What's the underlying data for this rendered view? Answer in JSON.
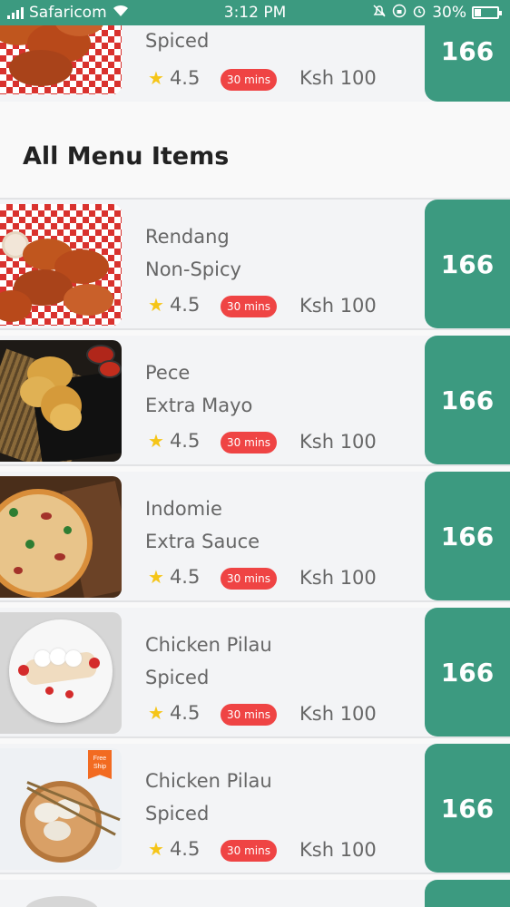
{
  "status_bar": {
    "carrier": "Safaricom",
    "time": "3:12 PM",
    "battery": "30%",
    "battery_level": 0.3
  },
  "top_item": {
    "variant": "Spiced",
    "rating": "4.5",
    "time": "30 mins",
    "price": "Ksh 100",
    "button": "166",
    "image": "chicken-wings-image"
  },
  "section_title": "All Menu Items",
  "items": [
    {
      "name": "Rendang",
      "variant": "Non-Spicy",
      "rating": "4.5",
      "time": "30 mins",
      "price": "Ksh 100",
      "button": "166",
      "image": "chicken-wings-image"
    },
    {
      "name": "Pece",
      "variant": "Extra Mayo",
      "rating": "4.5",
      "time": "30 mins",
      "price": "Ksh 100",
      "button": "166",
      "image": "fried-chicken-image"
    },
    {
      "name": "Indomie",
      "variant": "Extra Sauce",
      "rating": "4.5",
      "time": "30 mins",
      "price": "Ksh 100",
      "button": "166",
      "image": "pizza-image"
    },
    {
      "name": "Chicken Pilau",
      "variant": "Spiced",
      "rating": "4.5",
      "time": "30 mins",
      "price": "Ksh 100",
      "button": "166",
      "image": "crepes-image"
    },
    {
      "name": "Chicken Pilau",
      "variant": "Spiced",
      "rating": "4.5",
      "time": "30 mins",
      "price": "Ksh 100",
      "button": "166",
      "image": "dumplings-image",
      "badge": "Free Ship"
    }
  ],
  "colors": {
    "primary": "#3c9a80",
    "badge": "#ef4444",
    "star": "#f5c518"
  }
}
